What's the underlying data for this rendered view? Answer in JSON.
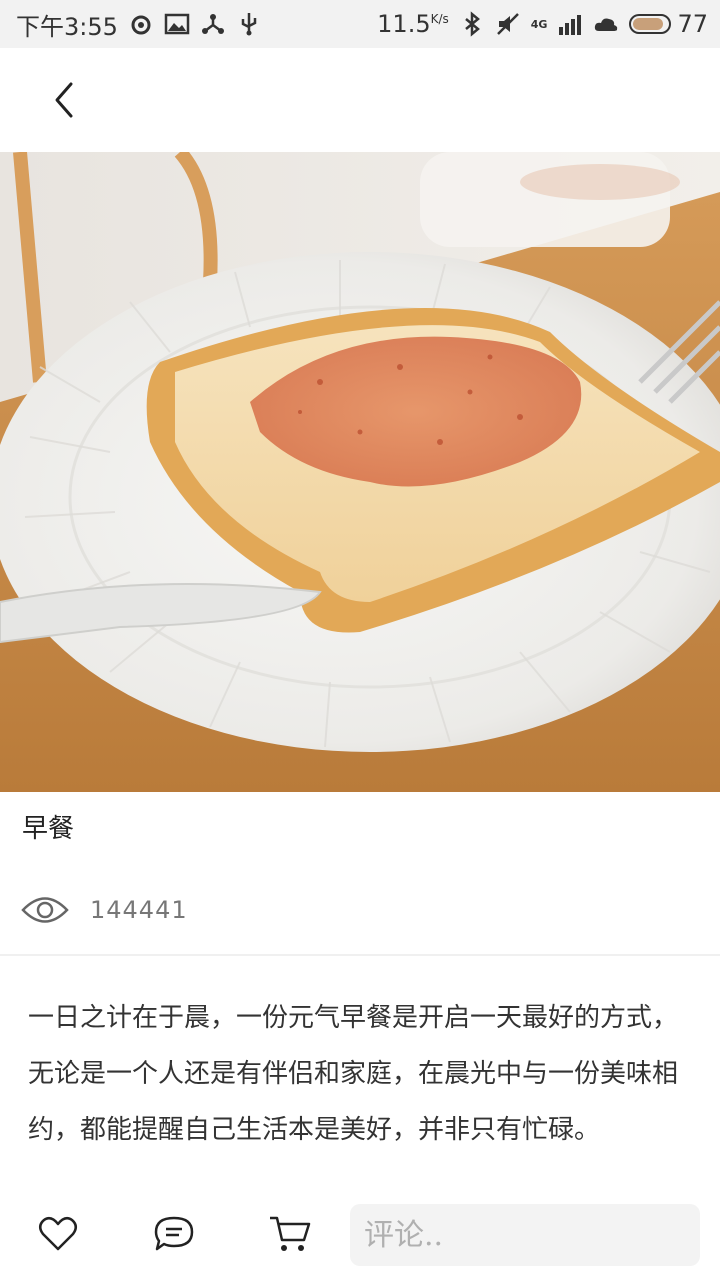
{
  "status_bar": {
    "time": "下午3:55",
    "speed_value": "11.5",
    "speed_unit": "K/s",
    "network": "4G",
    "battery_level": "77",
    "icons": [
      "weibo-icon",
      "image-icon",
      "share-icon",
      "usb-icon",
      "bluetooth-icon",
      "mute-icon",
      "signal-icon",
      "cloud-icon",
      "battery-icon"
    ]
  },
  "header": {
    "back_icon": "chevron-left-icon"
  },
  "article": {
    "title": "早餐",
    "view_count": "144441",
    "description": "一日之计在于晨，一份元气早餐是开启一天最好的方式，无论是一个人还是有伴侣和家庭，在晨光中与一份美味相约，都能提醒自己生活本是美好，并非只有忙碌。"
  },
  "bottom_bar": {
    "like_icon": "heart-icon",
    "comment_icon": "comment-icon",
    "cart_icon": "cart-icon",
    "comment_placeholder": "评论.."
  },
  "colors": {
    "status_bg": "#f2f2f2",
    "table_wood": "#c98a4a",
    "plate": "#f4f4f2",
    "bread_crust": "#e6b25f",
    "jam": "#d9673f"
  }
}
